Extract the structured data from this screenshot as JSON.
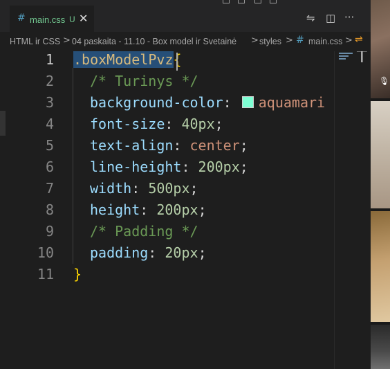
{
  "tab": {
    "icon": "css-hash-icon",
    "hash": "#",
    "filename": "main.css",
    "status": "U",
    "close": "✕"
  },
  "tab_actions": {
    "compare": "⇋",
    "split": "◫",
    "more": "···"
  },
  "breadcrumb": {
    "items": [
      "HTML ir CSS",
      "04 paskaita - 11.10 - Box model ir Svetainė",
      "styles",
      "main.css"
    ],
    "separator": ">",
    "file_hash": "#",
    "symbol_icon": "⇌"
  },
  "editor": {
    "line_numbers": [
      "1",
      "2",
      "3",
      "4",
      "5",
      "6",
      "7",
      "8",
      "9",
      "10",
      "11"
    ],
    "lines": {
      "l1_selector": ".boxModelPvz",
      "l1_brace": "{",
      "l2_comment": "/* Turinys */",
      "l3_prop": "background-color",
      "l3_colon": ": ",
      "l3_value": "aquamari",
      "l4_prop": "font-size",
      "l4_colon": ": ",
      "l4_value": "40px",
      "l4_semi": ";",
      "l5_prop": "text-align",
      "l5_colon": ": ",
      "l5_value": "center",
      "l5_semi": ";",
      "l6_prop": "line-height",
      "l6_colon": ": ",
      "l6_value": "200px",
      "l6_semi": ";",
      "l7_prop": "width",
      "l7_colon": ": ",
      "l7_value": "500px",
      "l7_semi": ";",
      "l8_prop": "height",
      "l8_colon": ": ",
      "l8_value": "200px",
      "l8_semi": ";",
      "l9_comment": "/* Padding */",
      "l10_prop": "padding",
      "l10_colon": ": ",
      "l10_value": "20px",
      "l10_semi": ";",
      "l11_brace": "}"
    },
    "swatch_color": "#7fffd4",
    "minimap_letter": "T"
  },
  "colors": {
    "editor_bg": "#1e1e1e",
    "tab_bar_bg": "#252526",
    "modified_green": "#73c991",
    "css_icon_blue": "#519aba",
    "selection": "#264f78"
  }
}
